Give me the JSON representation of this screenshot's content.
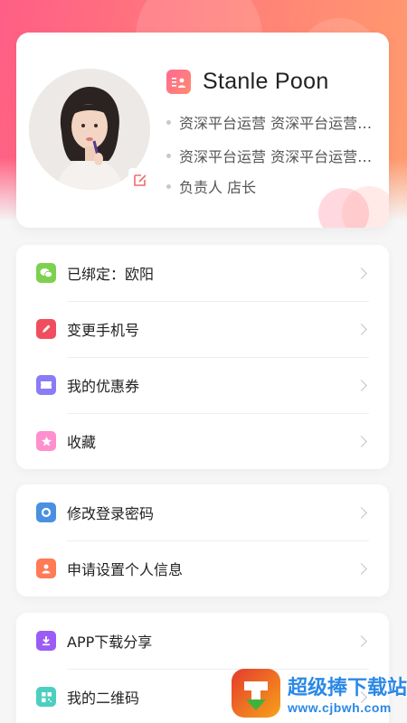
{
  "profile": {
    "name": "Stanle Poon",
    "info": [
      "资深平台运营 资深平台运营 资深平台运营",
      "资深平台运营 资深平台运营 资深平台运营",
      "负责人 店长"
    ]
  },
  "menu_groups": [
    {
      "items": [
        {
          "label": "已绑定：欧阳",
          "icon": "wechat-icon",
          "color": "#7ed04f"
        },
        {
          "label": "变更手机号",
          "icon": "pencil-icon",
          "color": "#f04e5e"
        },
        {
          "label": "我的优惠券",
          "icon": "coupon-icon",
          "color": "#8a7cf6"
        },
        {
          "label": "收藏",
          "icon": "star-icon",
          "color": "#ff8fcf"
        }
      ]
    },
    {
      "items": [
        {
          "label": "修改登录密码",
          "icon": "lock-ring-icon",
          "color": "#4a90e2"
        },
        {
          "label": "申请设置个人信息",
          "icon": "person-icon",
          "color": "#ff7a55"
        }
      ]
    },
    {
      "items": [
        {
          "label": "APP下载分享",
          "icon": "download-icon",
          "color": "#9b5cf5"
        },
        {
          "label": "我的二维码",
          "icon": "qrcode-icon",
          "color": "#4ccfc0"
        }
      ]
    }
  ],
  "watermark": {
    "title": "超级捧下载站",
    "url": "www.cjbwh.com"
  },
  "colors": {
    "header_gradient_start": "#ff5e86",
    "header_gradient_end": "#ff9c6d",
    "accent": "#ff6a93"
  }
}
